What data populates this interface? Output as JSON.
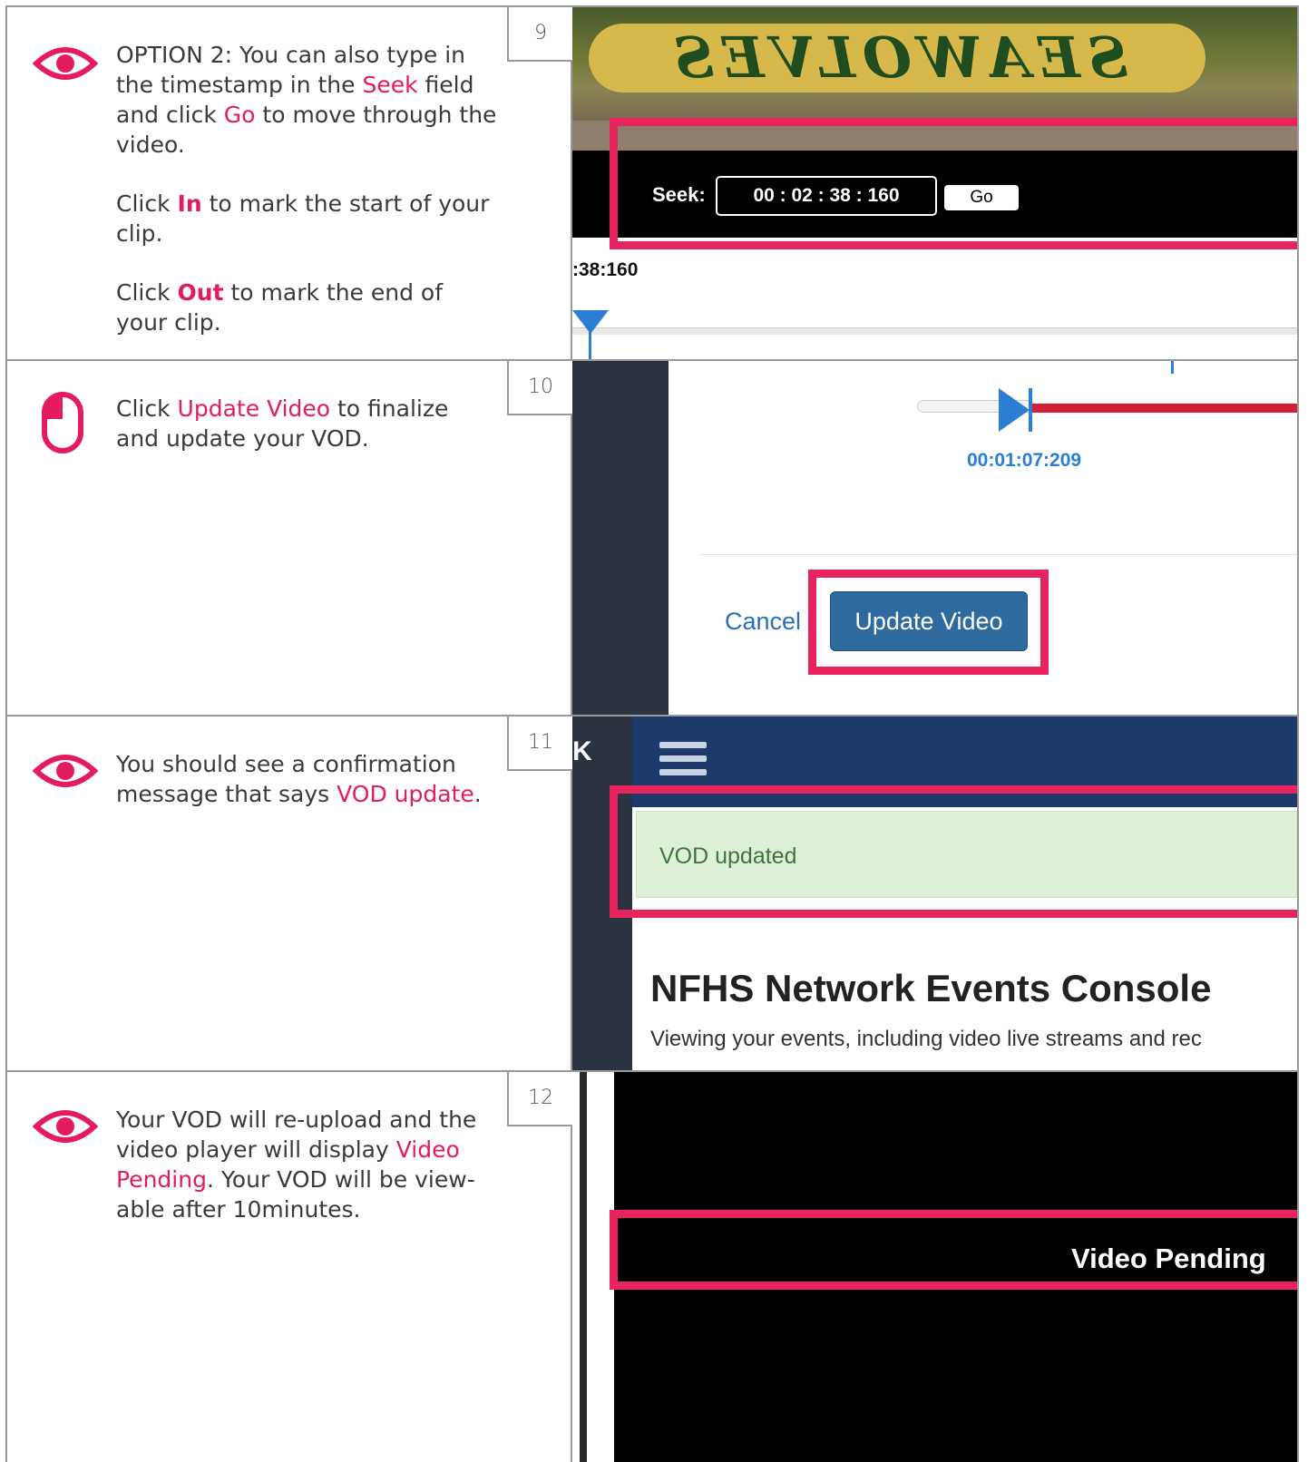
{
  "steps": [
    {
      "number": "9",
      "icon": "eye-icon",
      "paragraphs": [
        [
          "OPTION 2: You can also type in the timestamp in the ",
          {
            "hl": "Seek"
          },
          " field and click ",
          {
            "hl": "Go"
          },
          " to move through the video."
        ],
        [
          "Click ",
          {
            "hl": "In"
          },
          " to mark the start of your clip."
        ],
        [
          "Click ",
          {
            "hl": "Out"
          },
          " to mark the end of your clip."
        ]
      ],
      "screenshot": {
        "banner_text": "SEAWOLVES",
        "seek_label": "Seek:",
        "seek_value": "00  :  02  :  38  :  160",
        "go_label": "Go",
        "time_label": ":38:160"
      }
    },
    {
      "number": "10",
      "icon": "mouse-icon",
      "paragraphs": [
        [
          "Click ",
          {
            "hl": "Update Video"
          },
          " to finalize and update your VOD."
        ]
      ],
      "screenshot": {
        "time_label": "00:01:07:209",
        "cancel_label": "Cancel",
        "update_label": "Update Video"
      }
    },
    {
      "number": "11",
      "icon": "eye-icon",
      "paragraphs": [
        [
          "You should see a confirmation message that says ",
          {
            "hl": "VOD update"
          },
          "."
        ]
      ],
      "screenshot": {
        "brand_fragment": "K",
        "alert_text": "VOD updated",
        "title": "NFHS Network Events Console",
        "subtitle": "Viewing your events, including video live streams and rec"
      }
    },
    {
      "number": "12",
      "icon": "eye-icon",
      "paragraphs": [
        [
          "Your VOD will re-upload and the video player will display ",
          {
            "hl": "Video Pending"
          },
          ". Your VOD will be view-able after 10minutes."
        ]
      ],
      "screenshot": {
        "status_text": "Video Pending"
      }
    }
  ],
  "colors": {
    "accent": "#e31c5f",
    "highlight_box": "#e8245f",
    "border": "#9a9a9a"
  }
}
